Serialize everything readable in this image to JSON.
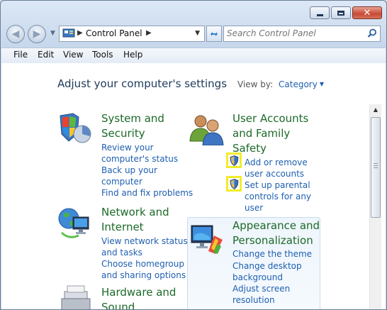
{
  "window": {
    "breadcrumb": "Control Panel",
    "search_placeholder": "Search Control Panel"
  },
  "menu": [
    "File",
    "Edit",
    "View",
    "Tools",
    "Help"
  ],
  "page": {
    "heading": "Adjust your computer's settings",
    "view_by_label": "View by:",
    "view_by_value": "Category"
  },
  "categories": [
    {
      "title_lines": [
        "System and",
        "Security"
      ],
      "links": [
        "Review your",
        "computer's status",
        "Back up your",
        "computer",
        "Find and fix problems"
      ]
    },
    {
      "title_lines": [
        "Network and",
        "Internet"
      ],
      "links": [
        "View network status",
        "and tasks",
        "Choose homegroup",
        "and sharing options"
      ]
    },
    {
      "title_lines": [
        "Hardware and",
        "Sound"
      ]
    },
    {
      "title_lines": [
        "User Accounts",
        "and Family",
        "Safety"
      ],
      "links": [
        "Add or remove",
        "user accounts",
        "Set up parental",
        "controls for any",
        "user"
      ]
    },
    {
      "title_lines": [
        "Appearance and",
        "Personalization"
      ],
      "links": [
        "Change the theme",
        "Change desktop",
        "background",
        "Adjust screen",
        "resolution"
      ]
    }
  ],
  "colors": {
    "category_title": "#1c6a28",
    "link": "#1e5fb0",
    "heading": "#1e395b",
    "highlight_border": "#f2ec2c"
  },
  "icons": [
    "back-arrow-icon",
    "forward-arrow-icon",
    "control-panel-icon",
    "refresh-icon",
    "search-icon",
    "uac-shield-icon"
  ]
}
